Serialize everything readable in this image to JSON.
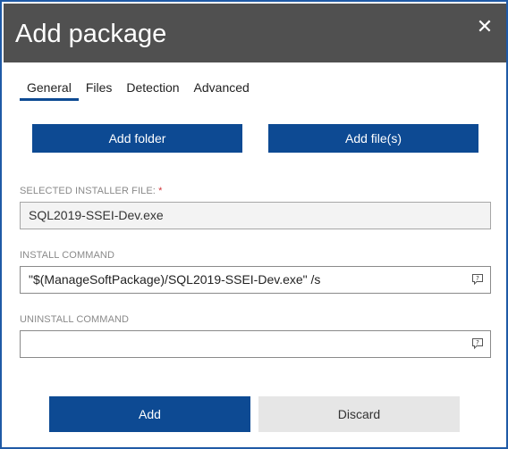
{
  "dialog": {
    "title": "Add package",
    "close_glyph": "✕"
  },
  "tabs": [
    {
      "label": "General",
      "active": true
    },
    {
      "label": "Files",
      "active": false
    },
    {
      "label": "Detection",
      "active": false
    },
    {
      "label": "Advanced",
      "active": false
    }
  ],
  "actions": {
    "add_folder_label": "Add folder",
    "add_files_label": "Add file(s)"
  },
  "installer_file": {
    "label": "SELECTED INSTALLER FILE:",
    "required_mark": "*",
    "value": "SQL2019-SSEI-Dev.exe"
  },
  "install_command": {
    "label": "INSTALL COMMAND",
    "value": "\"$(ManageSoftPackage)/SQL2019-SSEI-Dev.exe\" /s",
    "help_icon": "comment-help-icon"
  },
  "uninstall_command": {
    "label": "UNINSTALL COMMAND",
    "value": "",
    "help_icon": "comment-help-icon"
  },
  "footer": {
    "add_label": "Add",
    "discard_label": "Discard"
  },
  "colors": {
    "accent": "#0d4a93",
    "titlebar": "#505050",
    "border": "#1f5aa6",
    "required": "#d13438"
  }
}
